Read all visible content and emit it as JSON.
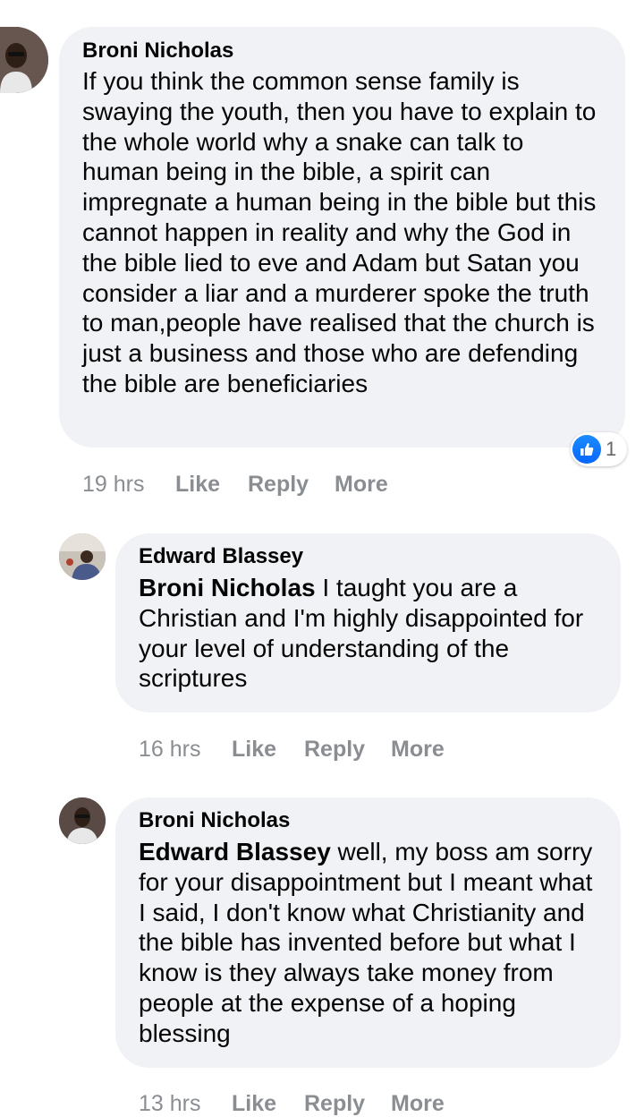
{
  "comments": [
    {
      "author": "Broni Nicholas",
      "text": "If you think the common sense family is swaying the youth, then you have to explain to the whole world why a snake can talk to human being in the bible, a spirit can impregnate a human being in the bible but this cannot happen in reality and why the God in the bible lied to eve and Adam but Satan you consider a liar and a murderer spoke the truth to man,people have realised that the church is just a business and those who are defending the bible are beneficiaries",
      "reaction_count": "1",
      "time": "19 hrs",
      "like_label": "Like",
      "reply_label": "Reply",
      "more_label": "More"
    },
    {
      "author": "Edward Blassey",
      "mention": "Broni Nicholas",
      "text": " I taught you are a Christian and I'm highly disappointed for your level of understanding of the scriptures",
      "time": "16 hrs",
      "like_label": "Like",
      "reply_label": "Reply",
      "more_label": "More"
    },
    {
      "author": "Broni Nicholas",
      "mention": "Edward Blassey",
      "text": " well, my boss am sorry for your disappointment but I meant what I said, I don't know what Christianity and the bible has invented before but what I know is they always take money from people at the expense of a hoping blessing",
      "time": "13 hrs",
      "like_label": "Like",
      "reply_label": "Reply",
      "more_label": "More"
    }
  ],
  "colors": {
    "bubble": "#f0f2f5",
    "meta": "#8a8d91",
    "like_blue": "#0866ff"
  },
  "icons": {
    "reaction": "thumbs-up-icon"
  }
}
